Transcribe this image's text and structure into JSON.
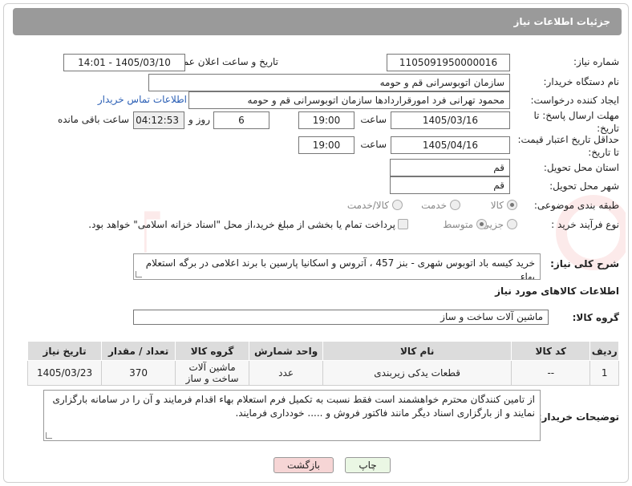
{
  "header": {
    "title": "جزئیات اطلاعات نیاز"
  },
  "form": {
    "need_number_label": "شماره نیاز:",
    "need_number": "1105091950000016",
    "announce_label": "تاریخ و ساعت اعلان عمومی:",
    "announce_value": "1405/03/10 - 14:01",
    "buyer_org_label": "نام دستگاه خریدار:",
    "buyer_org": "سازمان اتوبوسرانی قم و حومه",
    "requester_label": "ایجاد کننده درخواست:",
    "requester": "محمود تهرانی فرد امورقراردادها سازمان اتوبوسرانی قم و حومه",
    "buyer_contact_link": "اطلاعات تماس خریدار",
    "reply_deadline_label_1": "مهلت ارسال پاسخ: تا",
    "reply_deadline_label_2": "تاریخ:",
    "reply_date": "1405/03/16",
    "time_label": "ساعت",
    "reply_time": "19:00",
    "days_value": "6",
    "days_label": "روز و",
    "remaining_time": "04:12:53",
    "remaining_label": "ساعت باقی مانده",
    "price_deadline_label_1": "حداقل تاریخ اعتبار قیمت:",
    "price_deadline_label_2": "تا تاریخ:",
    "price_date": "1405/04/16",
    "price_time": "19:00",
    "province_label": "استان محل تحویل:",
    "province": "قم",
    "city_label": "شهر محل تحویل:",
    "city": "قم",
    "category_label": "طبقه بندی موضوعی:",
    "category_options": [
      "کالا",
      "خدمت",
      "کالا/خدمت"
    ],
    "category_selected": "کالا",
    "process_label": "نوع فرآیند خرید :",
    "process_options": [
      "جزیی",
      "متوسط"
    ],
    "process_selected": "متوسط",
    "payment_note": "پرداخت تمام یا بخشی از مبلغ خرید،از محل \"اسناد خزانه اسلامی\" خواهد بود."
  },
  "description": {
    "label": "شرح کلی نیاز:",
    "text": "خرید کیسه باد اتوبوس شهری - بنز 457 ، آتروس و اسکانیا پارسین با برند اعلامی در برگه استعلام بهاء"
  },
  "goods": {
    "section_title": "اطلاعات کالاهای مورد نیاز",
    "group_label": "گروه کالا:",
    "group_value": "ماشین آلات ساخت و ساز",
    "columns": [
      "ردیف",
      "کد کالا",
      "نام کالا",
      "واحد شمارش",
      "گروه کالا",
      "تعداد / مقدار",
      "تاریخ نیاز"
    ],
    "rows": [
      {
        "row": "1",
        "code": "--",
        "name": "قطعات یدکی زیربندی",
        "unit": "عدد",
        "group_line1": "ماشین آلات",
        "group_line2": "ساخت و ساز",
        "qty": "370",
        "date": "1405/03/23"
      }
    ]
  },
  "buyer_notes": {
    "label": "توضیحات خریدار:",
    "text": "از تامین کنندگان محترم خواهشمند است فقط نسبت به تکمیل فرم استعلام بهاء اقدام فرمایند و آن را در سامانه بارگزاری نمایند و از بارگزاری اسناد دیگر مانند فاکتور فروش و ..... خودداری فرمایند."
  },
  "buttons": {
    "print": "چاپ",
    "back": "بازگشت"
  },
  "watermark": {
    "text": "AriaTender.neT"
  },
  "colors": {
    "header_bg": "#9a9a9a",
    "link": "#2b5fb5",
    "back_bg": "#f6d5d5",
    "print_bg": "#eaf7e4"
  }
}
